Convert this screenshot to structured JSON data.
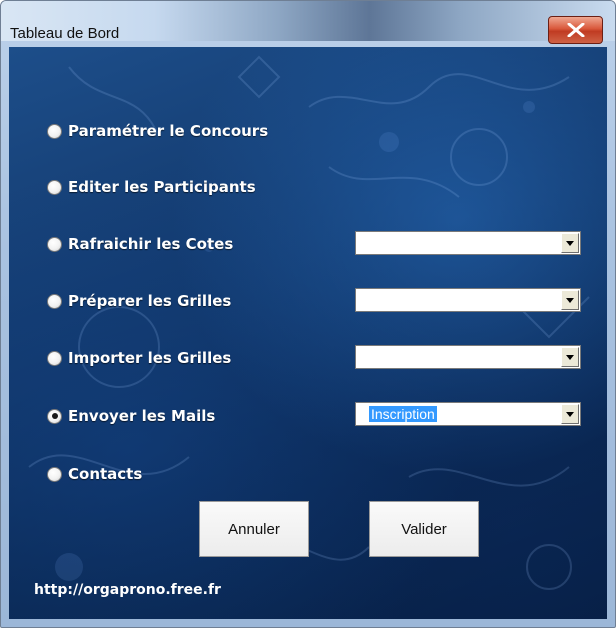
{
  "window": {
    "title": "Tableau de Bord"
  },
  "options": [
    {
      "label": "Paramétrer le Concours",
      "checked": false
    },
    {
      "label": "Editer les Participants",
      "checked": false
    },
    {
      "label": "Rafraichir les Cotes",
      "checked": false
    },
    {
      "label": "Préparer les Grilles",
      "checked": false
    },
    {
      "label": "Importer les Grilles",
      "checked": false
    },
    {
      "label": "Envoyer les Mails",
      "checked": true
    },
    {
      "label": "Contacts",
      "checked": false
    }
  ],
  "combos": {
    "cotes": {
      "value": ""
    },
    "preparer": {
      "value": ""
    },
    "importer": {
      "value": ""
    },
    "mails": {
      "value": "Inscription"
    }
  },
  "buttons": {
    "cancel": "Annuler",
    "ok": "Valider"
  },
  "footer": {
    "url": "http://orgaprono.free.fr"
  }
}
